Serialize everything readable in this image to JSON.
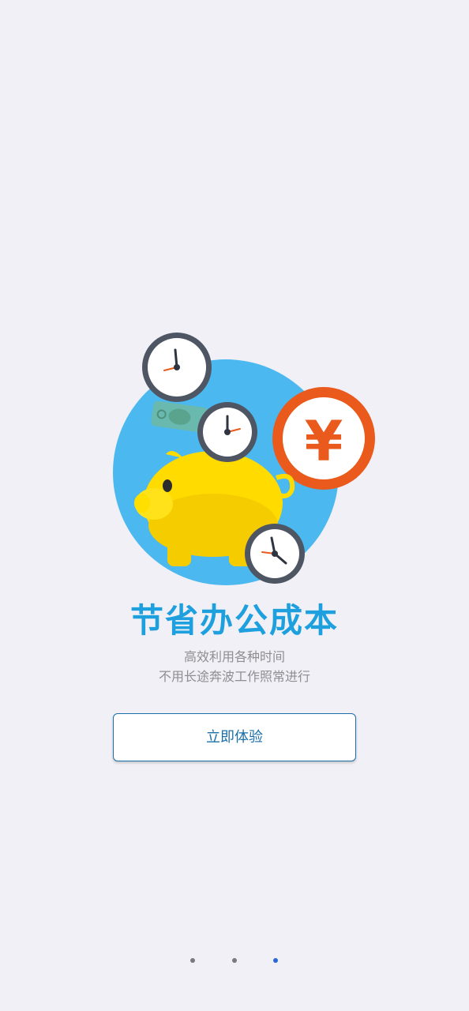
{
  "guide": {
    "title": "节省办公成本",
    "subtitle_line1": "高效利用各种时间",
    "subtitle_line2": "不用长途奔波工作照常进行",
    "cta_label": "立即体验",
    "currency_symbol": "¥"
  },
  "pager": {
    "page_count": 3,
    "active_page": 3
  },
  "colors": {
    "background": "#f1f0f6",
    "title": "#1ea0de",
    "accent": "#1b6fa8",
    "circle_bg": "#4cb8f0",
    "pig": "#ffd800",
    "coin_ring": "#e95a1c",
    "dot_inactive": "#7a7a7e",
    "dot_active": "#2a68d6"
  },
  "icons": [
    "clock-icon",
    "piggy-bank-icon",
    "yuan-coin-icon",
    "banknote-icon"
  ]
}
